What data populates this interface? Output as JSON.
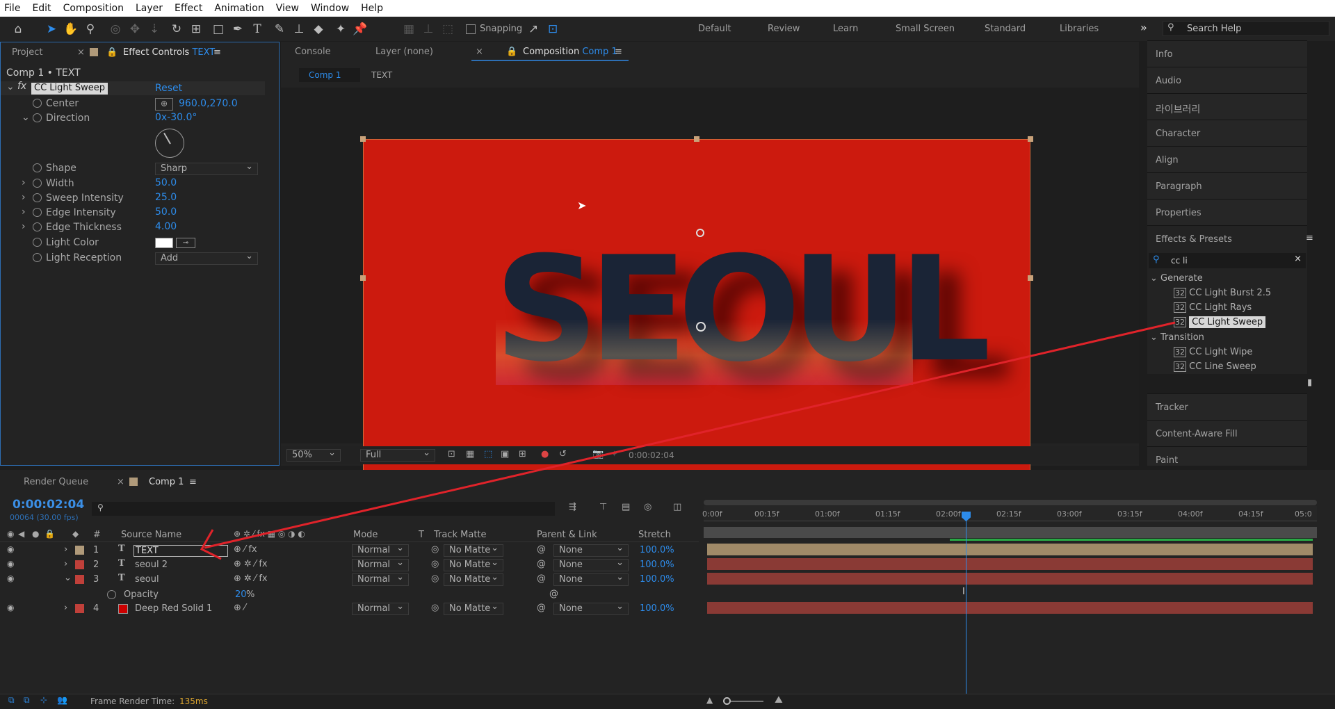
{
  "menu": [
    "File",
    "Edit",
    "Composition",
    "Layer",
    "Effect",
    "Animation",
    "View",
    "Window",
    "Help"
  ],
  "toolbar": {
    "snapping": "Snapping",
    "workspaces": [
      "Default",
      "Review",
      "Learn",
      "Small Screen",
      "Standard",
      "Libraries"
    ],
    "search_placeholder": "Search Help"
  },
  "left_panel": {
    "tab_project": "Project",
    "tab_effect_controls": "Effect Controls",
    "tab_effect_layer": "TEXT",
    "header": "Comp 1 • TEXT",
    "effect_name": "CC Light Sweep",
    "reset": "Reset",
    "props": {
      "center": {
        "label": "Center",
        "value": "960.0,270.0"
      },
      "direction": {
        "label": "Direction",
        "value": "0x-30.0°"
      },
      "shape": {
        "label": "Shape",
        "value": "Sharp"
      },
      "width": {
        "label": "Width",
        "value": "50.0"
      },
      "sweep_intensity": {
        "label": "Sweep Intensity",
        "value": "25.0"
      },
      "edge_intensity": {
        "label": "Edge Intensity",
        "value": "50.0"
      },
      "edge_thickness": {
        "label": "Edge Thickness",
        "value": "4.00"
      },
      "light_color": {
        "label": "Light Color"
      },
      "light_reception": {
        "label": "Light Reception",
        "value": "Add"
      }
    }
  },
  "center_panel": {
    "tab_console": "Console",
    "tab_layer": "Layer (none)",
    "tab_composition": "Composition",
    "tab_comp_name": "Comp 1",
    "crumb_comp": "Comp 1",
    "crumb_layer": "TEXT",
    "canvas_text": "SEOUL",
    "canvas_bg": "#cc1a0e",
    "zoom": "50%",
    "resolution": "Full",
    "timecode": "0:00:02:04"
  },
  "right_panel": {
    "items": [
      "Info",
      "Audio",
      "라이브러리",
      "Character",
      "Align",
      "Paragraph",
      "Properties"
    ],
    "effects_presets": "Effects & Presets",
    "search_value": "cc li",
    "tree": [
      {
        "group": "Generate",
        "items": [
          "CC Light Burst 2.5",
          "CC Light Rays",
          "CC Light Sweep"
        ]
      },
      {
        "group": "Transition",
        "items": [
          "CC Light Wipe",
          "CC Line Sweep"
        ]
      }
    ],
    "items_bottom": [
      "Tracker",
      "Content-Aware Fill",
      "Paint"
    ]
  },
  "timeline": {
    "tab_render": "Render Queue",
    "tab_comp": "Comp 1",
    "timecode": "0:00:02:04",
    "frames": "00064 (30.00 fps)",
    "headers": {
      "num": "#",
      "source": "Source Name",
      "mode": "Mode",
      "t": "T",
      "track_matte": "Track Matte",
      "parent": "Parent & Link",
      "stretch": "Stretch"
    },
    "layers": [
      {
        "num": "1",
        "name": "TEXT",
        "type": "text",
        "mode": "Normal",
        "matte": "No Matte",
        "parent": "None",
        "stretch": "100.0%",
        "color": "#b09a7a"
      },
      {
        "num": "2",
        "name": "seoul 2",
        "type": "text",
        "mode": "Normal",
        "matte": "No Matte",
        "parent": "None",
        "stretch": "100.0%",
        "color": "#c0403a"
      },
      {
        "num": "3",
        "name": "seoul",
        "type": "text",
        "mode": "Normal",
        "matte": "No Matte",
        "parent": "None",
        "stretch": "100.0%",
        "color": "#c0403a"
      },
      {
        "num": "4",
        "name": "Deep Red Solid 1",
        "type": "solid",
        "mode": "Normal",
        "matte": "No Matte",
        "parent": "None",
        "stretch": "100.0%",
        "color": "#c0403a"
      }
    ],
    "opacity": {
      "label": "Opacity",
      "value": "20",
      "unit": "%"
    },
    "ruler": [
      "0:00f",
      "00:15f",
      "01:00f",
      "01:15f",
      "02:00f",
      "02:15f",
      "03:00f",
      "03:15f",
      "04:00f",
      "04:15f",
      "05:0"
    ],
    "render_time_label": "Frame Render Time:",
    "render_time": "135ms"
  }
}
